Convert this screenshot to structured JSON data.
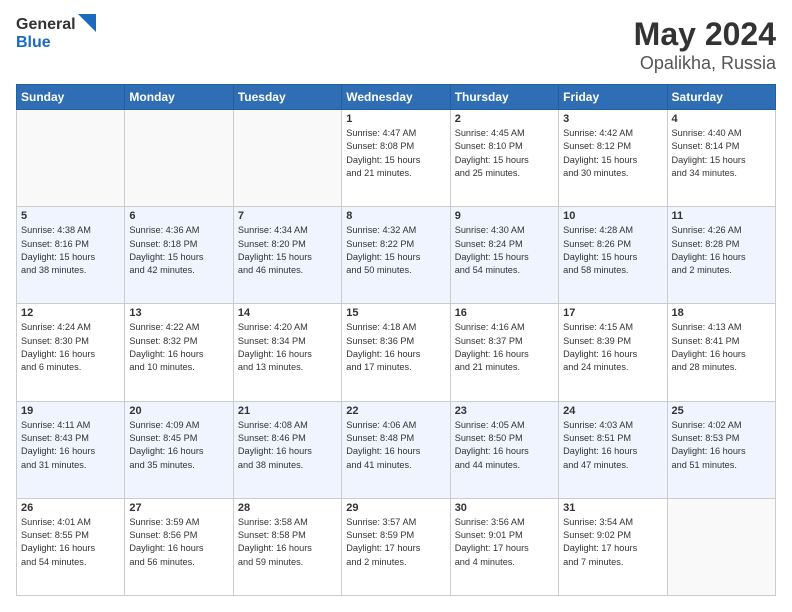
{
  "header": {
    "logo_line1": "General",
    "logo_line2": "Blue",
    "month_title": "May 2024",
    "location": "Opalikha, Russia"
  },
  "columns": [
    "Sunday",
    "Monday",
    "Tuesday",
    "Wednesday",
    "Thursday",
    "Friday",
    "Saturday"
  ],
  "weeks": [
    [
      {
        "day": "",
        "info": ""
      },
      {
        "day": "",
        "info": ""
      },
      {
        "day": "",
        "info": ""
      },
      {
        "day": "1",
        "info": "Sunrise: 4:47 AM\nSunset: 8:08 PM\nDaylight: 15 hours\nand 21 minutes."
      },
      {
        "day": "2",
        "info": "Sunrise: 4:45 AM\nSunset: 8:10 PM\nDaylight: 15 hours\nand 25 minutes."
      },
      {
        "day": "3",
        "info": "Sunrise: 4:42 AM\nSunset: 8:12 PM\nDaylight: 15 hours\nand 30 minutes."
      },
      {
        "day": "4",
        "info": "Sunrise: 4:40 AM\nSunset: 8:14 PM\nDaylight: 15 hours\nand 34 minutes."
      }
    ],
    [
      {
        "day": "5",
        "info": "Sunrise: 4:38 AM\nSunset: 8:16 PM\nDaylight: 15 hours\nand 38 minutes."
      },
      {
        "day": "6",
        "info": "Sunrise: 4:36 AM\nSunset: 8:18 PM\nDaylight: 15 hours\nand 42 minutes."
      },
      {
        "day": "7",
        "info": "Sunrise: 4:34 AM\nSunset: 8:20 PM\nDaylight: 15 hours\nand 46 minutes."
      },
      {
        "day": "8",
        "info": "Sunrise: 4:32 AM\nSunset: 8:22 PM\nDaylight: 15 hours\nand 50 minutes."
      },
      {
        "day": "9",
        "info": "Sunrise: 4:30 AM\nSunset: 8:24 PM\nDaylight: 15 hours\nand 54 minutes."
      },
      {
        "day": "10",
        "info": "Sunrise: 4:28 AM\nSunset: 8:26 PM\nDaylight: 15 hours\nand 58 minutes."
      },
      {
        "day": "11",
        "info": "Sunrise: 4:26 AM\nSunset: 8:28 PM\nDaylight: 16 hours\nand 2 minutes."
      }
    ],
    [
      {
        "day": "12",
        "info": "Sunrise: 4:24 AM\nSunset: 8:30 PM\nDaylight: 16 hours\nand 6 minutes."
      },
      {
        "day": "13",
        "info": "Sunrise: 4:22 AM\nSunset: 8:32 PM\nDaylight: 16 hours\nand 10 minutes."
      },
      {
        "day": "14",
        "info": "Sunrise: 4:20 AM\nSunset: 8:34 PM\nDaylight: 16 hours\nand 13 minutes."
      },
      {
        "day": "15",
        "info": "Sunrise: 4:18 AM\nSunset: 8:36 PM\nDaylight: 16 hours\nand 17 minutes."
      },
      {
        "day": "16",
        "info": "Sunrise: 4:16 AM\nSunset: 8:37 PM\nDaylight: 16 hours\nand 21 minutes."
      },
      {
        "day": "17",
        "info": "Sunrise: 4:15 AM\nSunset: 8:39 PM\nDaylight: 16 hours\nand 24 minutes."
      },
      {
        "day": "18",
        "info": "Sunrise: 4:13 AM\nSunset: 8:41 PM\nDaylight: 16 hours\nand 28 minutes."
      }
    ],
    [
      {
        "day": "19",
        "info": "Sunrise: 4:11 AM\nSunset: 8:43 PM\nDaylight: 16 hours\nand 31 minutes."
      },
      {
        "day": "20",
        "info": "Sunrise: 4:09 AM\nSunset: 8:45 PM\nDaylight: 16 hours\nand 35 minutes."
      },
      {
        "day": "21",
        "info": "Sunrise: 4:08 AM\nSunset: 8:46 PM\nDaylight: 16 hours\nand 38 minutes."
      },
      {
        "day": "22",
        "info": "Sunrise: 4:06 AM\nSunset: 8:48 PM\nDaylight: 16 hours\nand 41 minutes."
      },
      {
        "day": "23",
        "info": "Sunrise: 4:05 AM\nSunset: 8:50 PM\nDaylight: 16 hours\nand 44 minutes."
      },
      {
        "day": "24",
        "info": "Sunrise: 4:03 AM\nSunset: 8:51 PM\nDaylight: 16 hours\nand 47 minutes."
      },
      {
        "day": "25",
        "info": "Sunrise: 4:02 AM\nSunset: 8:53 PM\nDaylight: 16 hours\nand 51 minutes."
      }
    ],
    [
      {
        "day": "26",
        "info": "Sunrise: 4:01 AM\nSunset: 8:55 PM\nDaylight: 16 hours\nand 54 minutes."
      },
      {
        "day": "27",
        "info": "Sunrise: 3:59 AM\nSunset: 8:56 PM\nDaylight: 16 hours\nand 56 minutes."
      },
      {
        "day": "28",
        "info": "Sunrise: 3:58 AM\nSunset: 8:58 PM\nDaylight: 16 hours\nand 59 minutes."
      },
      {
        "day": "29",
        "info": "Sunrise: 3:57 AM\nSunset: 8:59 PM\nDaylight: 17 hours\nand 2 minutes."
      },
      {
        "day": "30",
        "info": "Sunrise: 3:56 AM\nSunset: 9:01 PM\nDaylight: 17 hours\nand 4 minutes."
      },
      {
        "day": "31",
        "info": "Sunrise: 3:54 AM\nSunset: 9:02 PM\nDaylight: 17 hours\nand 7 minutes."
      },
      {
        "day": "",
        "info": ""
      }
    ]
  ]
}
